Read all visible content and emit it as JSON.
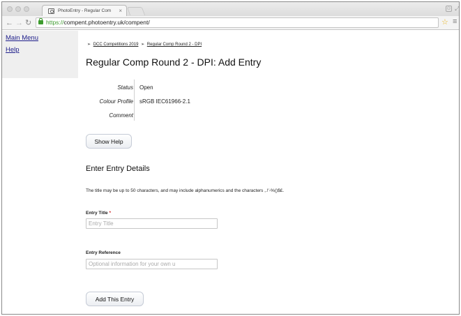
{
  "browser": {
    "tab_title": "PhotoEntry - Regular Com",
    "tab_close": "×",
    "url_scheme": "https://",
    "url_rest": "compent.photoentry.uk/compent/"
  },
  "sidebar": {
    "items": [
      {
        "label": "Main Menu"
      },
      {
        "label": "Help"
      }
    ]
  },
  "breadcrumb": {
    "items": [
      {
        "label": "DCC Competitions 2019"
      },
      {
        "label": "Regular Comp Round 2 - DPI"
      }
    ],
    "separator": "➢"
  },
  "page_title": "Regular Comp Round 2 - DPI: Add Entry",
  "info": [
    {
      "label": "Status",
      "value": "Open"
    },
    {
      "label": "Colour Profile",
      "value": "sRGB IEC61966-2.1"
    },
    {
      "label": "Comment",
      "value": ""
    }
  ],
  "show_help_label": "Show Help",
  "section_title": "Enter Entry Details",
  "help_text": "The title may be up to 50 characters, and may include alphanumerics and the characters ,.!'-%()$£.",
  "entry_title": {
    "label": "Entry Title",
    "required_mark": "*",
    "placeholder": "Entry Title",
    "value": ""
  },
  "entry_reference": {
    "label": "Entry Reference",
    "placeholder": "Optional information for your own u",
    "value": ""
  },
  "add_entry_label": "Add This Entry",
  "colors": {
    "link": "#1d1d8a",
    "https_green": "#3d9b2e",
    "required": "#cc2222",
    "sidebar_bg": "#efefef"
  }
}
